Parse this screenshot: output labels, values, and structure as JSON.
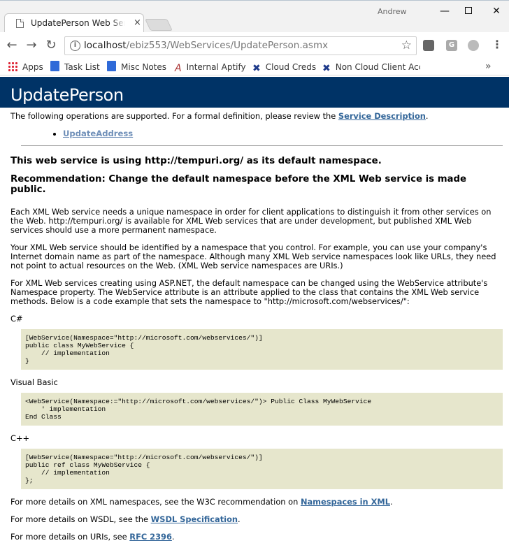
{
  "browser": {
    "tab_title": "UpdatePerson Web Service",
    "tab_close": "×",
    "profile_name": "Andrew",
    "url_host": "localhost",
    "url_path": "/ebiz553/WebServices/UpdatePerson.asmx",
    "bookmarks": [
      {
        "label": "Apps"
      },
      {
        "label": "Task List"
      },
      {
        "label": "Misc Notes"
      },
      {
        "label": "Internal Aptify"
      },
      {
        "label": "Cloud Creds"
      },
      {
        "label": "Non Cloud Client Acc"
      }
    ],
    "ext2_letter": "G"
  },
  "page": {
    "title": "UpdatePerson",
    "intro_prefix": "The following operations are supported. For a formal definition, please review the",
    "service_description_link": "Service Description",
    "intro_suffix": ".",
    "operations": [
      "UpdateAddress"
    ],
    "namespace_heading": "This web service is using http://tempuri.org/ as its default namespace.",
    "recommendation_heading": "Recommendation: Change the default namespace before the XML Web service is made public.",
    "para1": "Each XML Web service needs a unique namespace in order for client applications to distinguish it from other services on the Web. http://tempuri.org/ is available for XML Web services that are under development, but published XML Web services should use a more permanent namespace.",
    "para2": "Your XML Web service should be identified by a namespace that you control. For example, you can use your company's Internet domain name as part of the namespace. Although many XML Web service namespaces look like URLs, they need not point to actual resources on the Web. (XML Web service namespaces are URIs.)",
    "para3": "For XML Web services creating using ASP.NET, the default namespace can be changed using the WebService attribute's Namespace property. The WebService attribute is an attribute applied to the class that contains the XML Web service methods. Below is a code example that sets the namespace to \"http://microsoft.com/webservices/\":",
    "csharp_label": "C#",
    "csharp_code": "[WebService(Namespace=\"http://microsoft.com/webservices/\")]\npublic class MyWebService {\n    // implementation\n}",
    "vb_label": "Visual Basic",
    "vb_code": "<WebService(Namespace:=\"http://microsoft.com/webservices/\")> Public Class MyWebService\n    ' implementation\nEnd Class",
    "cpp_label": "C++",
    "cpp_code": "[WebService(Namespace=\"http://microsoft.com/webservices/\")]\npublic ref class MyWebService {\n    // implementation\n};",
    "xml_ns_prefix": "For more details on XML namespaces, see the W3C recommendation on",
    "xml_ns_link": "Namespaces in XML",
    "wsdl_prefix": "For more details on WSDL, see the",
    "wsdl_link": "WSDL Specification",
    "uri_prefix": "For more details on URIs, see",
    "uri_link": "RFC 2396",
    "period": "."
  }
}
